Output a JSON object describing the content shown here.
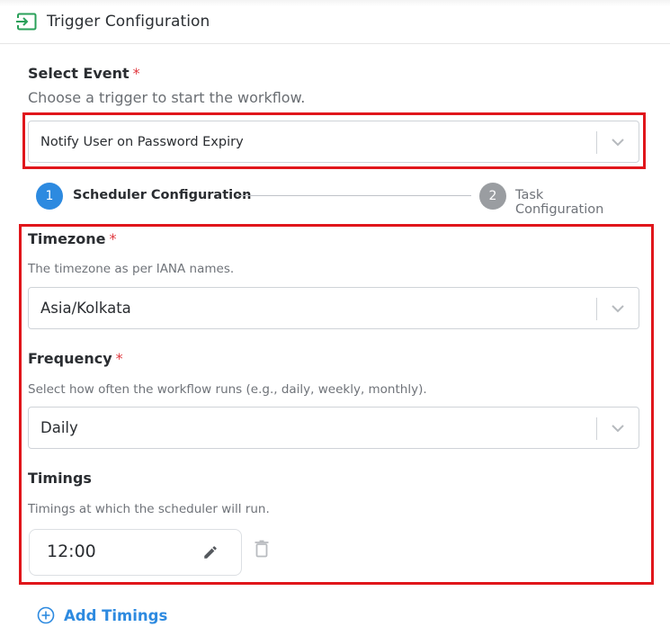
{
  "header": {
    "title": "Trigger Configuration",
    "icon": "enter-icon",
    "icon_color": "#2aa05a"
  },
  "select_event": {
    "label": "Select Event",
    "required_mark": "*",
    "description": "Choose a trigger to start the workflow.",
    "value": "Notify User on Password Expiry"
  },
  "stepper": {
    "steps": [
      {
        "number": "1",
        "label": "Scheduler Configuration",
        "active": true
      },
      {
        "number": "2",
        "label": "Task Configuration",
        "active": false
      }
    ]
  },
  "timezone": {
    "label": "Timezone",
    "required_mark": "*",
    "description": "The timezone as per IANA names.",
    "value": "Asia/Kolkata"
  },
  "frequency": {
    "label": "Frequency",
    "required_mark": "*",
    "description": "Select how often the workflow runs (e.g., daily, weekly, monthly).",
    "value": "Daily"
  },
  "timings": {
    "label": "Timings",
    "description": "Timings at which the scheduler will run.",
    "items": [
      {
        "value": "12:00"
      }
    ],
    "add_label": "Add Timings"
  },
  "colors": {
    "accent": "#2d8ae0",
    "required": "#e0383e",
    "highlight_border": "#e0161b",
    "step_inactive": "#9a9da1"
  }
}
